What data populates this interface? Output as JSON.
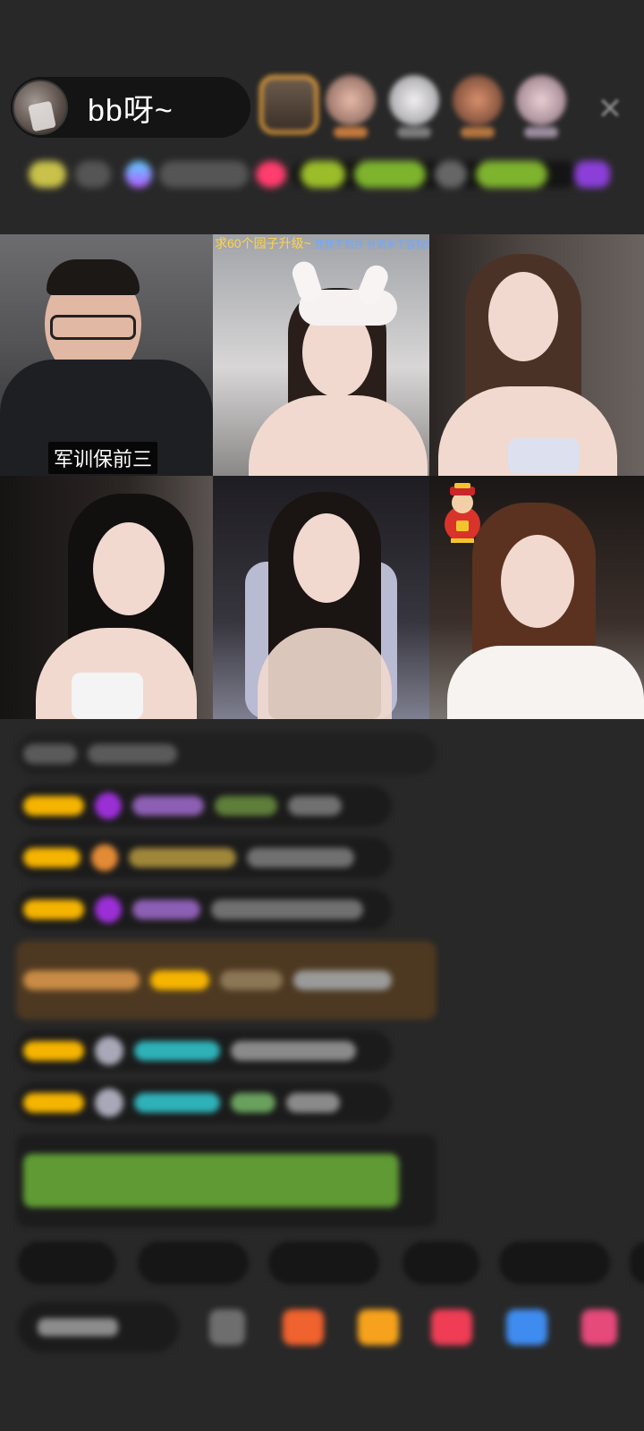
{
  "host": {
    "name": "bb呀~"
  },
  "video": {
    "tile2_banner_main": "求60个园子升级~",
    "tile2_banner_sub": "我我不到井 脊调来下容我的无能",
    "tile1_caption": "军训保前三"
  },
  "colors": {
    "accent_orange": "#f0a53a",
    "badge_yellow": "#f5b400",
    "purple_gem": "#9b2fd6",
    "teal_name": "#2fb1b8",
    "green_notice": "#7fcf3d",
    "gift_bg": "#4d3921"
  },
  "icons": {
    "close": "close-icon",
    "fortune": "fortune-god-icon"
  }
}
